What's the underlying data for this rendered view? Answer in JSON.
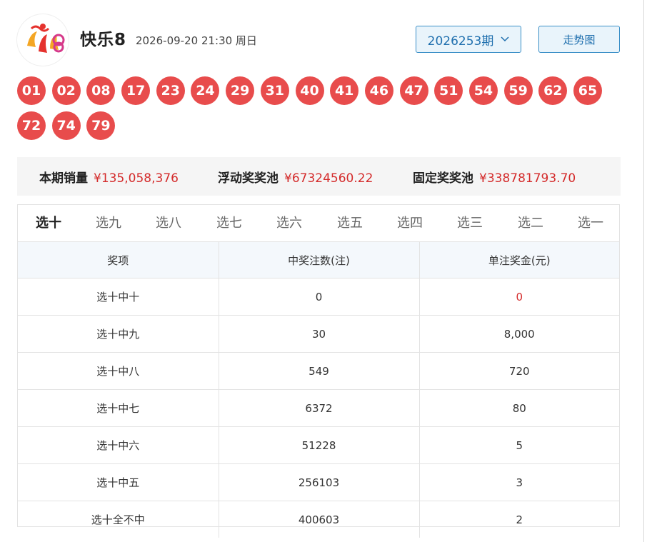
{
  "header": {
    "logo_text": "快乐8",
    "title": "快乐8",
    "draw_time": "2026-09-20 21:30 周日",
    "issue": "2026253期",
    "trend_button": "走势图"
  },
  "balls": [
    "01",
    "02",
    "08",
    "17",
    "23",
    "24",
    "29",
    "31",
    "40",
    "41",
    "46",
    "47",
    "51",
    "54",
    "59",
    "62",
    "65",
    "72",
    "74",
    "79"
  ],
  "stats": {
    "sales_label": "本期销量",
    "sales_value": "¥135,058,376",
    "float_pool_label": "浮动奖奖池",
    "float_pool_value": "¥67324560.22",
    "fixed_pool_label": "固定奖奖池",
    "fixed_pool_value": "¥338781793.70"
  },
  "tabs": [
    "选十",
    "选九",
    "选八",
    "选七",
    "选六",
    "选五",
    "选四",
    "选三",
    "选二",
    "选一"
  ],
  "active_tab": "选十",
  "table": {
    "headers": [
      "奖项",
      "中奖注数(注)",
      "单注奖金(元)"
    ],
    "rows": [
      {
        "prize": "选十中十",
        "count": "0",
        "amount": "0"
      },
      {
        "prize": "选十中九",
        "count": "30",
        "amount": "8,000"
      },
      {
        "prize": "选十中八",
        "count": "549",
        "amount": "720"
      },
      {
        "prize": "选十中七",
        "count": "6372",
        "amount": "80"
      },
      {
        "prize": "选十中六",
        "count": "51228",
        "amount": "5"
      },
      {
        "prize": "选十中五",
        "count": "256103",
        "amount": "3"
      },
      {
        "prize": "选十全不中",
        "count": "400603",
        "amount": "2"
      }
    ]
  },
  "colors": {
    "ball": "#e84c4c",
    "accent": "#1f6fae",
    "highlight_red": "#d42b2b"
  }
}
